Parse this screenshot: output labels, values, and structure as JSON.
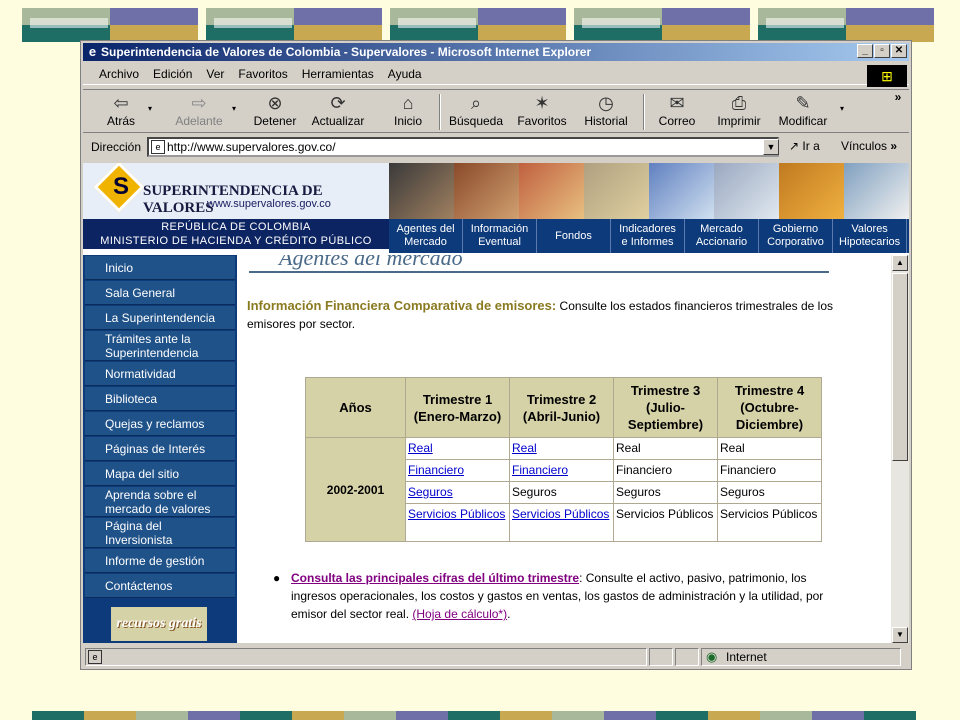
{
  "window": {
    "title": "Superintendencia de Valores de Colombia - Supervalores - Microsoft Internet Explorer",
    "minimize": "_",
    "maximize": "▫",
    "close": "✕"
  },
  "menu": [
    "Archivo",
    "Edición",
    "Ver",
    "Favoritos",
    "Herramientas",
    "Ayuda"
  ],
  "toolbar": {
    "back": "Atrás",
    "forward": "Adelante",
    "stop": "Detener",
    "refresh": "Actualizar",
    "home": "Inicio",
    "search": "Búsqueda",
    "favorites": "Favoritos",
    "history": "Historial",
    "mail": "Correo",
    "print": "Imprimir",
    "edit": "Modificar",
    "more": "»"
  },
  "address": {
    "label": "Dirección",
    "url": "http://www.supervalores.gov.co/",
    "go": "Ir a",
    "links": "Vínculos"
  },
  "banner": {
    "title": "SUPERINTENDENCIA DE VALORES",
    "url": "www.supervalores.gov.co",
    "line1": "REPÚBLICA DE COLOMBIA",
    "line2": "MINISTERIO DE HACIENDA Y CRÉDITO PÚBLICO",
    "nav": [
      {
        "l1": "Agentes del",
        "l2": "Mercado"
      },
      {
        "l1": "Información",
        "l2": "Eventual"
      },
      {
        "l1": "Fondos",
        "l2": ""
      },
      {
        "l1": "Indicadores",
        "l2": "e Informes"
      },
      {
        "l1": "Mercado",
        "l2": "Accionario"
      },
      {
        "l1": "Gobierno",
        "l2": "Corporativo"
      },
      {
        "l1": "Valores",
        "l2": "Hipotecarios"
      }
    ]
  },
  "sidebar": [
    {
      "l1": "Inicio",
      "l2": ""
    },
    {
      "l1": "Sala General",
      "l2": ""
    },
    {
      "l1": "La Superintendencia",
      "l2": ""
    },
    {
      "l1": "Trámites ante la",
      "l2": "Superintendencia"
    },
    {
      "l1": "Normatividad",
      "l2": ""
    },
    {
      "l1": "Biblioteca",
      "l2": ""
    },
    {
      "l1": "Quejas y reclamos",
      "l2": ""
    },
    {
      "l1": "Páginas de Interés",
      "l2": ""
    },
    {
      "l1": "Mapa del sitio",
      "l2": ""
    },
    {
      "l1": "Aprenda sobre el",
      "l2": "mercado de valores"
    },
    {
      "l1": "Página del",
      "l2": "Inversionista"
    },
    {
      "l1": "Informe de gestión",
      "l2": ""
    },
    {
      "l1": "Contáctenos",
      "l2": ""
    }
  ],
  "recursos": "recursos gratis",
  "main": {
    "section": "Agentes del mercado",
    "info_title": "Información Financiera Comparativa de emisores:",
    "info_text": " Consulte los estados financieros trimestrales de los emisores por sector.",
    "table": {
      "headers": [
        "Años",
        "Trimestre 1 (Enero-Marzo)",
        "Trimestre 2 (Abril-Junio)",
        "Trimestre 3 (Julio-Septiembre)",
        "Trimestre 4 (Octubre-Diciembre)"
      ],
      "year": "2002-2001",
      "rows": [
        [
          "Real",
          "Real",
          "Real",
          "Real"
        ],
        [
          "Financiero",
          "Financiero",
          "Financiero",
          "Financiero"
        ],
        [
          "Seguros",
          "Seguros",
          "Seguros",
          "Seguros"
        ],
        [
          "Servicios Públicos",
          "Servicios Públicos",
          "Servicios Públicos",
          "Servicios Públicos"
        ]
      ]
    },
    "bullet_link": "Consulta las principales cifras del último trimestre",
    "bullet_text": ": Consulte el activo, pasivo, patrimonio, los ingresos operacionales, los costos y gastos en ventas, los gastos de administración y la utilidad, por emisor del sector real. ",
    "bullet_link2": "(Hoja de cálculo*)",
    "bullet_end": "."
  },
  "status": {
    "zone": "Internet"
  },
  "colors": {
    "deco_gray": "#a8b89a",
    "deco_purple": "#7070a8",
    "deco_teal": "#1e6e66",
    "deco_gold": "#c8a850",
    "nav_blue": "#0d3a7a",
    "table_tan": "#d6d2a8"
  }
}
